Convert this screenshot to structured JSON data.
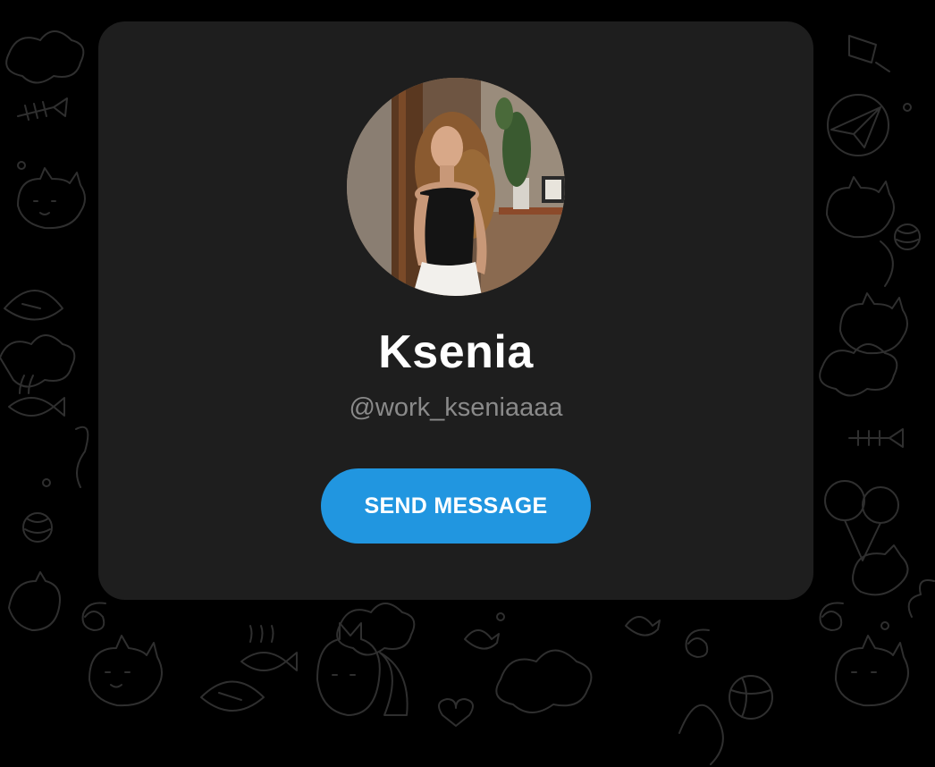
{
  "profile": {
    "name": "Ksenia",
    "username": "@work_kseniaaaa",
    "send_button_label": "SEND MESSAGE"
  },
  "colors": {
    "background": "#000000",
    "card": "#1e1e1e",
    "accent": "#2196e0",
    "username_text": "#8a8a8a",
    "pattern_stroke": "#2f2f2f"
  },
  "icons": {
    "background_doodles": [
      "cat",
      "fish-bone",
      "paper-plane",
      "balloons",
      "yarn-ball",
      "cloud",
      "heart",
      "spiral",
      "bowl",
      "fox"
    ]
  }
}
